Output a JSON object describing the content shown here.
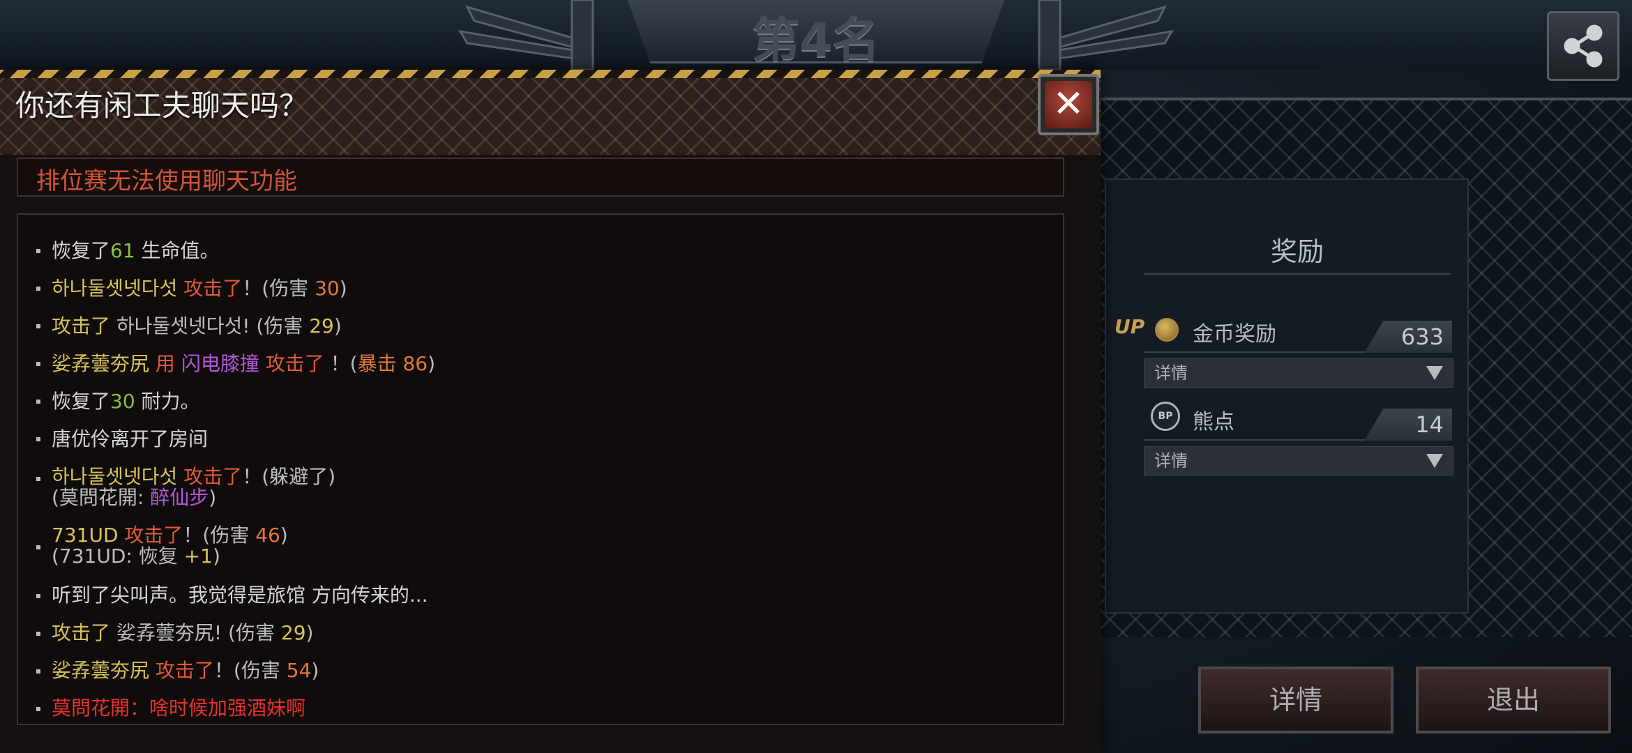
{
  "header": {
    "rank_title": "第4名"
  },
  "reward": {
    "title": "奖励",
    "gold": {
      "up_badge": "UP",
      "label": "金币奖励",
      "value": "633",
      "dropdown_label": "详情"
    },
    "bear_points": {
      "icon_text": "BP",
      "label": "熊点",
      "value": "14",
      "dropdown_label": "详情"
    }
  },
  "buttons": {
    "details": "详情",
    "exit": "退出"
  },
  "chat": {
    "title": "你还有闲工夫聊天吗？",
    "close_symbol": "✕",
    "notice": "排位赛无法使用聊天功能",
    "log": [
      {
        "parts": [
          "恢复了",
          "61",
          " 生命值。"
        ]
      },
      {
        "parts": [
          "하나둘셋넷다섯",
          "  攻击了",
          "！(伤害 ",
          "30",
          ")"
        ]
      },
      {
        "parts": [
          "攻击了",
          " 하나둘셋넷다섯! (伤害 ",
          "29",
          ")"
        ]
      },
      {
        "parts": [
          "娑孨蕓夯尻",
          "  用 ",
          "闪电膝撞",
          " 攻击了",
          " ！(",
          "暴击 ",
          "86",
          ")"
        ]
      },
      {
        "parts": [
          "恢复了",
          "30",
          " 耐力。"
        ]
      },
      {
        "parts": [
          "唐优伶离开了房间"
        ]
      },
      {
        "parts": [
          "하나둘셋넷다섯",
          "  攻击了",
          "！(躲避了)"
        ],
        "sub": [
          "(莫問花開: ",
          "醉仙步",
          ")"
        ]
      },
      {
        "parts": [
          "731UD",
          "  攻击了",
          "！(伤害 ",
          "46",
          ")"
        ],
        "sub": [
          "(731UD: 恢复 ",
          "+1",
          ")"
        ]
      },
      {
        "parts": [
          "听到了尖叫声。我觉得是旅馆 方向传来的..."
        ]
      },
      {
        "parts": [
          "攻击了",
          " 娑孨蕓夯尻! (伤害 ",
          "29",
          ")"
        ]
      },
      {
        "parts": [
          "娑孨蕓夯尻",
          "  攻击了",
          "！(伤害 ",
          "54",
          ")"
        ]
      },
      {
        "parts": [
          "莫問花開：啥时候加强酒妹啊"
        ]
      }
    ]
  },
  "colors": {
    "heal_green": "#8ac03c",
    "attack_red": "#e05a3a",
    "damage_orange": "#e07a32",
    "name_yellow": "#d8c35a",
    "skill_purple": "#b058d8",
    "chat_crimson": "#e8302a"
  }
}
